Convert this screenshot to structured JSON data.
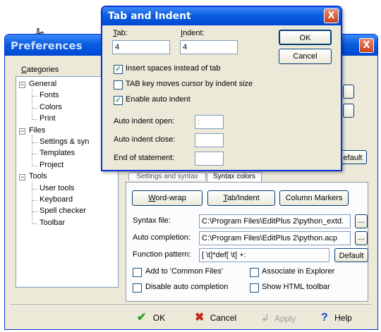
{
  "preferences": {
    "title": "Preferences",
    "categories_label": "Categories",
    "tree": [
      {
        "label": "General",
        "level": 0,
        "expander": "−"
      },
      {
        "label": "Fonts",
        "level": 1
      },
      {
        "label": "Colors",
        "level": 1
      },
      {
        "label": "Print",
        "level": 1
      },
      {
        "label": "Files",
        "level": 0,
        "expander": "−"
      },
      {
        "label": "Settings & syn",
        "level": 1
      },
      {
        "label": "Templates",
        "level": 1
      },
      {
        "label": "Project",
        "level": 1
      },
      {
        "label": "Tools",
        "level": 0,
        "expander": "−"
      },
      {
        "label": "User tools",
        "level": 1
      },
      {
        "label": "Keyboard",
        "level": 1
      },
      {
        "label": "Spell checker",
        "level": 1
      },
      {
        "label": "Toolbar",
        "level": 1
      }
    ],
    "default_button_partial": "efault",
    "tabs": [
      "Settings and syntax",
      "Syntax colors"
    ],
    "buttons": {
      "word_wrap": "Word-wrap",
      "tab_indent": "Tab/Indent",
      "column_markers": "Column Markers"
    },
    "syntax_file_label": "Syntax file:",
    "syntax_file_value": "C:\\Program Files\\EditPlus 2\\python_extd.",
    "auto_completion_label": "Auto completion:",
    "auto_completion_value": "C:\\Program Files\\EditPlus 2\\python.acp",
    "browse_label": "...",
    "function_pattern_label": "Function pattern:",
    "function_pattern_value": "[ \\t]*def[ \\t] +:",
    "default_label": "Default",
    "checkboxes": {
      "add_common_files": "Add to 'Common Files'",
      "associate_explorer": "Associate in Explorer",
      "disable_auto_completion": "Disable auto completion",
      "show_html_toolbar": "Show HTML toolbar"
    },
    "footer": {
      "ok": "OK",
      "cancel": "Cancel",
      "apply": "Apply",
      "help": "Help"
    },
    "close_glyph": "X"
  },
  "tab_indent": {
    "title": "Tab and Indent",
    "close_glyph": "X",
    "tab_label": "Tab:",
    "tab_value": "4",
    "indent_label": "Indent:",
    "indent_value": "4",
    "ok": "OK",
    "cancel": "Cancel",
    "insert_spaces": "Insert spaces instead of tab",
    "tab_key_moves": "TAB key moves cursor by indent size",
    "enable_auto_indent": "Enable auto indent",
    "checks": {
      "insert_spaces": true,
      "tab_key_moves": false,
      "enable_auto_indent": true
    },
    "auto_indent_open_label": "Auto indent open:",
    "auto_indent_open_value": ":",
    "auto_indent_close_label": "Auto indent close:",
    "auto_indent_close_value": "",
    "end_of_statement_label": "End of statement:",
    "end_of_statement_value": ""
  },
  "colors": {
    "title_bar": "#0a5ee0",
    "dialog_bg": "#ece9d8",
    "checkmark": "#21a121",
    "cancel_x": "#c0281b",
    "help_q": "#1646c8"
  }
}
